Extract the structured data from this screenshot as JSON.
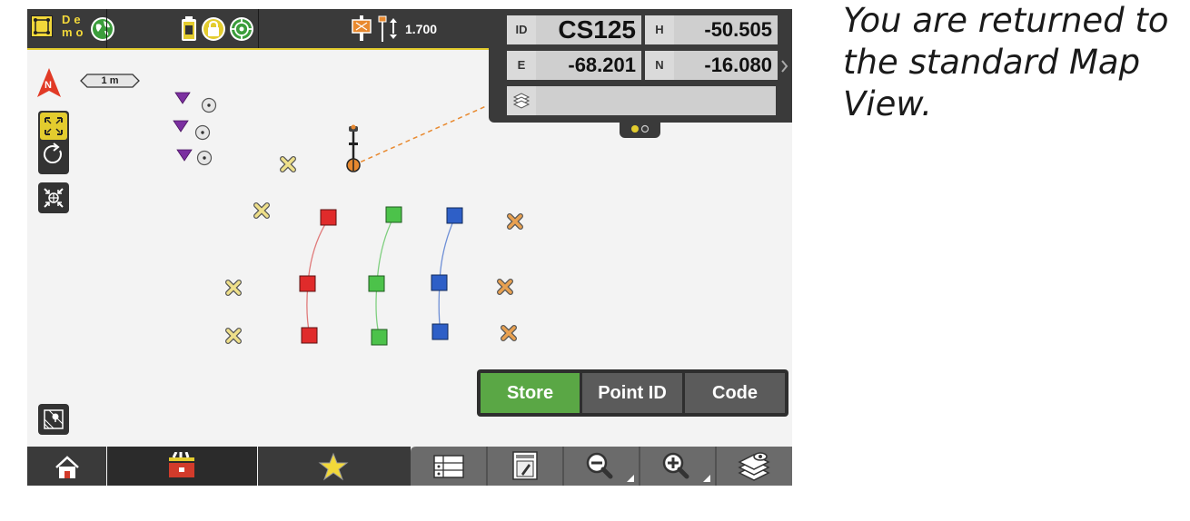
{
  "caption": {
    "text": "You are returned to the standard Map View."
  },
  "topbar": {
    "demo_label": "De mo",
    "antenna_height": "1.700",
    "icons": [
      "demo-icon",
      "globe-icon",
      "battery-icon",
      "lock-icon",
      "target-icon",
      "prism-icon",
      "antenna-height-icon"
    ]
  },
  "info_panel": {
    "id_label": "ID",
    "id_value": "CS125",
    "h_label": "H",
    "h_value": "-50.505",
    "e_label": "E",
    "e_value": "-68.201",
    "n_label": "N",
    "n_value": "-16.080",
    "code_value": ""
  },
  "map": {
    "north_label": "N",
    "scale_label": "1 m",
    "colors": {
      "red": "#e02b2b",
      "green": "#4cc24a",
      "blue": "#2e5fc7",
      "yellow": "#efe08a",
      "orange": "#e8a050",
      "purple": "#7b2fa0",
      "accent": "#e3cc2e"
    }
  },
  "actions": {
    "store": "Store",
    "point_id": "Point ID",
    "code": "Code"
  },
  "bottombar": {
    "items": [
      "home-icon",
      "toolbox-icon",
      "favorites-icon",
      "table-icon",
      "edit-icon",
      "zoom-out-icon",
      "zoom-in-icon",
      "layers-icon"
    ]
  }
}
